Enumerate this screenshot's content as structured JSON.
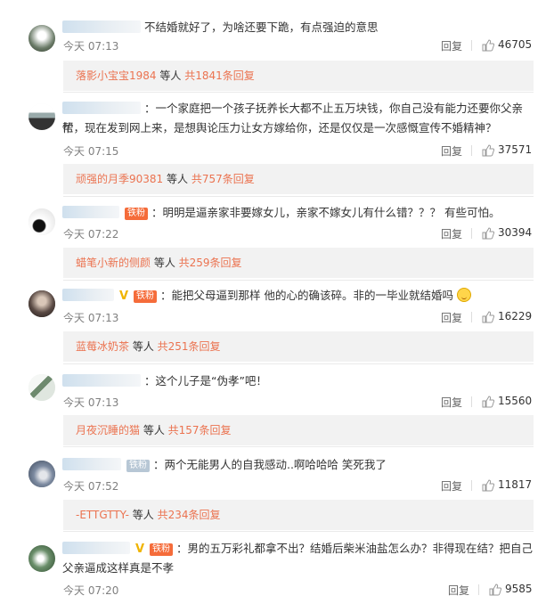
{
  "comments": [
    {
      "text": "不结婚就好了，为啥还要下跪，有点强迫的意思",
      "time": "今天 07:13",
      "reply": "回复",
      "likes": "46705",
      "more_user": "落影小宝宝1984",
      "more_mid": " 等人 ",
      "more_total": "共1841条回复"
    },
    {
      "text_a": "：一个家庭把一个孩子抚养长大都不止五万块钱，你自己没有能力还要你父亲帮",
      "text_b": "忙，现在发到网上来，是想舆论压力让女方嫁给你，还是仅仅是一次感慨宣传不婚精神？",
      "time": "今天 07:15",
      "reply": "回复",
      "likes": "37571",
      "more_user": "顽强的月季90381",
      "more_mid": " 等人 ",
      "more_total": "共757条回复"
    },
    {
      "badge": "铁粉",
      "text": "：明明是逼亲家非要嫁女儿，亲家不嫁女儿有什么错？？？ 有些可怕。",
      "time": "今天 07:22",
      "reply": "回复",
      "likes": "30394",
      "more_user": "蜡笔小新的侧颜",
      "more_mid": " 等人 ",
      "more_total": "共259条回复"
    },
    {
      "vip": "V",
      "badge": "铁粉",
      "text": "：能把父母逼到那样 他的心的确该碎。非的一毕业就结婚吗",
      "time": "今天 07:13",
      "reply": "回复",
      "likes": "16229",
      "more_user": "蓝莓冰奶茶",
      "more_mid": " 等人 ",
      "more_total": "共251条回复"
    },
    {
      "text": "：这个儿子是“伪孝”吧！",
      "time": "今天 07:13",
      "reply": "回复",
      "likes": "15560",
      "more_user": "月夜沉睡的猫",
      "more_mid": " 等人 ",
      "more_total": "共157条回复"
    },
    {
      "badge": "铁粉",
      "text": "：两个无能男人的自我感动..啊哈哈哈 笑死我了",
      "time": "今天 07:52",
      "reply": "回复",
      "likes": "11817",
      "more_user": "-ETTGTTY-",
      "more_mid": " 等人 ",
      "more_total": "共234条回复"
    },
    {
      "vip": "V",
      "badge": "铁粉",
      "text_a": "：男的五万彩礼都拿不出？结婚后柴米油盐怎么办？非得现在结？把自己",
      "text_b": "父亲逼成这样真是不孝",
      "time": "今天 07:20",
      "reply": "回复",
      "likes": "9585"
    }
  ],
  "colors": {
    "link": "#eb7350",
    "meta": "#808080",
    "fan_badge": "#f56c3a",
    "vip": "#f0b400"
  },
  "icons": {
    "like": "thumbs-up-icon"
  }
}
